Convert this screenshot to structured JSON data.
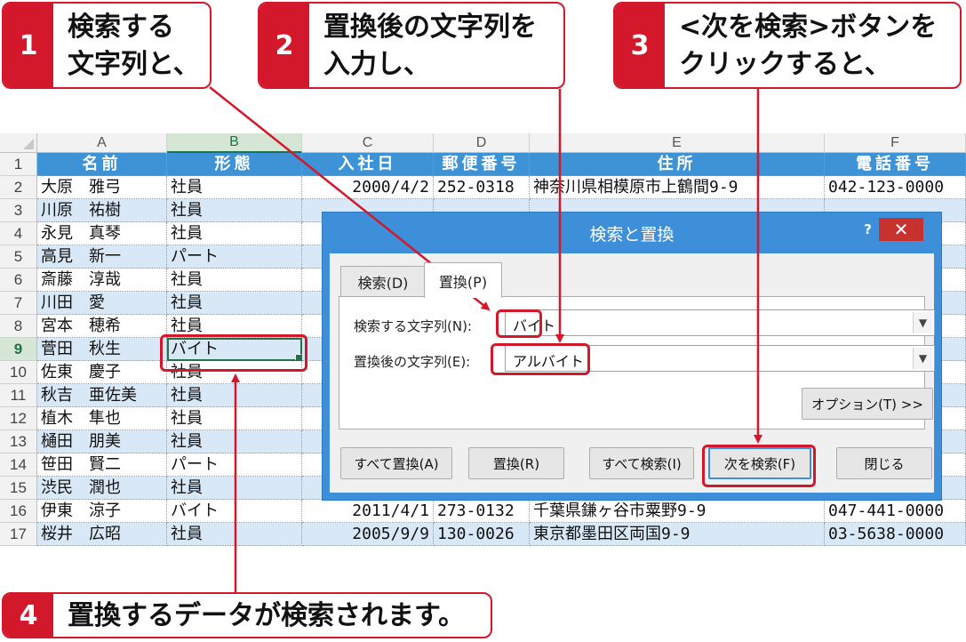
{
  "callouts": [
    {
      "num": "1",
      "text": "検索する\n文字列と、"
    },
    {
      "num": "2",
      "text": "置換後の文字列を\n入力し、"
    },
    {
      "num": "3",
      "text": "<次を検索>ボタンを\nクリックすると、"
    },
    {
      "num": "4",
      "text": "置換するデータが検索されます。"
    }
  ],
  "sheet": {
    "columns": [
      "A",
      "B",
      "C",
      "D",
      "E",
      "F"
    ],
    "selected_column": "B",
    "selected_row": "9",
    "rows": [
      {
        "n": "1",
        "cells": [
          "名前",
          "形態",
          "入社日",
          "郵便番号",
          "住所",
          "電話番号"
        ]
      },
      {
        "n": "2",
        "cells": [
          "大原　雅弓",
          "社員",
          "2000/4/2",
          "252-0318",
          "神奈川県相模原市上鶴間9-9",
          "042-123-0000"
        ]
      },
      {
        "n": "3",
        "cells": [
          "川原　祐樹",
          "社員",
          "",
          "",
          "",
          ""
        ]
      },
      {
        "n": "4",
        "cells": [
          "永見　真琴",
          "社員",
          "",
          "",
          "",
          ""
        ]
      },
      {
        "n": "5",
        "cells": [
          "高見　新一",
          "パート",
          "",
          "",
          "",
          ""
        ]
      },
      {
        "n": "6",
        "cells": [
          "斎藤　淳哉",
          "社員",
          "",
          "",
          "",
          ""
        ]
      },
      {
        "n": "7",
        "cells": [
          "川田　愛",
          "社員",
          "",
          "",
          "",
          ""
        ]
      },
      {
        "n": "8",
        "cells": [
          "宮本　穂希",
          "社員",
          "",
          "",
          "",
          ""
        ]
      },
      {
        "n": "9",
        "cells": [
          "菅田　秋生",
          "バイト",
          "",
          "",
          "",
          ""
        ]
      },
      {
        "n": "10",
        "cells": [
          "佐東　慶子",
          "社員",
          "",
          "",
          "",
          ""
        ]
      },
      {
        "n": "11",
        "cells": [
          "秋吉　亜佐美",
          "社員",
          "",
          "",
          "",
          ""
        ]
      },
      {
        "n": "12",
        "cells": [
          "植木　隼也",
          "社員",
          "",
          "",
          "",
          ""
        ]
      },
      {
        "n": "13",
        "cells": [
          "樋田　朋美",
          "社員",
          "",
          "",
          "",
          ""
        ]
      },
      {
        "n": "14",
        "cells": [
          "笹田　賢二",
          "パート",
          "",
          "",
          "",
          ""
        ]
      },
      {
        "n": "15",
        "cells": [
          "渋民　潤也",
          "社員",
          "",
          "",
          "",
          ""
        ]
      },
      {
        "n": "16",
        "cells": [
          "伊東　涼子",
          "バイト",
          "2011/4/1",
          "273-0132",
          "千葉県鎌ヶ谷市粟野9-9",
          "047-441-0000"
        ]
      },
      {
        "n": "17",
        "cells": [
          "桜井　広昭",
          "社員",
          "2005/9/9",
          "130-0026",
          "東京都墨田区両国9-9",
          "03-5638-0000"
        ]
      }
    ]
  },
  "dialog": {
    "title": "検索と置換",
    "help": "?",
    "close": "✕",
    "tabs": {
      "search": "検索(D)",
      "replace": "置換(P)"
    },
    "find_label": "検索する文字列(N):",
    "find_value": "バイト",
    "replace_label": "置換後の文字列(E):",
    "replace_value": "アルバイト",
    "options_button": "オプション(T) >>",
    "buttons": {
      "replace_all": "すべて置換(A)",
      "replace": "置換(R)",
      "find_all": "すべて検索(I)",
      "find_next": "次を検索(F)",
      "close": "閉じる"
    }
  },
  "colors": {
    "accent": "#d3182b",
    "header_fill": "#3e93d6",
    "band_fill": "#d9e8f6",
    "dialog_frame": "#3c8fd8",
    "selection": "#217346"
  }
}
